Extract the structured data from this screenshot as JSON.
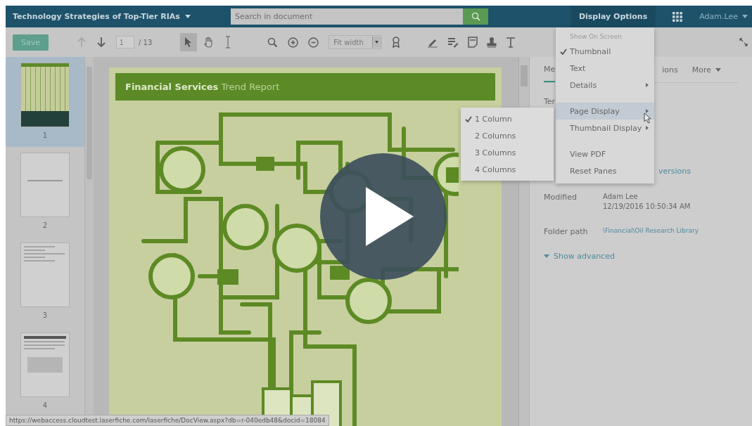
{
  "header": {
    "title": "Technology Strategies of Top-Tier RIAs",
    "search": {
      "placeholder": "Search in document"
    },
    "display_options": "Display Options",
    "user": "Adam.Lee"
  },
  "toolbar": {
    "save": "Save",
    "prev_disabled": true,
    "page": "1",
    "page_total": "/ 13",
    "zoom": "Fit width",
    "tools": [
      {
        "kind": "pointer",
        "selected": true
      },
      {
        "kind": "hand",
        "selected": false
      },
      {
        "kind": "text-select",
        "selected": false
      }
    ]
  },
  "thumbnails": [
    {
      "label": "1",
      "kind": "cover",
      "selected": true
    },
    {
      "label": "2",
      "kind": "title",
      "selected": false
    },
    {
      "label": "3",
      "kind": "contents",
      "selected": false
    },
    {
      "label": "4",
      "kind": "text",
      "selected": false
    }
  ],
  "document": {
    "heading": "**Financial Services** Trend Report"
  },
  "details_pane": {
    "tabs": [
      {
        "label": "Me",
        "selected": true
      },
      {
        "label": "ions",
        "selected": false
      },
      {
        "label": "More",
        "selected": false
      }
    ],
    "partial_label": "Ter",
    "versions_link": "versions",
    "fields": [
      {
        "label": "Modified",
        "kind": "text",
        "values": [
          "Adam Lee",
          "12/19/2016 10:50:34 AM"
        ]
      },
      {
        "label": "Folder path",
        "kind": "link",
        "values": [
          "\\Financial\\Oil Research Library"
        ]
      }
    ],
    "show_advanced": "Show advanced"
  },
  "display_menu": {
    "section": "Show On Screen",
    "items": [
      {
        "label": "Thumbnail",
        "kind": "check",
        "checked": true,
        "highlighted": false
      },
      {
        "label": "Text",
        "kind": "check",
        "checked": false,
        "highlighted": false
      },
      {
        "label": "Details",
        "kind": "submenu",
        "highlighted": false
      },
      {
        "kind": "separator"
      },
      {
        "label": "Page Display",
        "kind": "submenu",
        "highlighted": true
      },
      {
        "label": "Thumbnail Display",
        "kind": "submenu",
        "highlighted": false
      },
      {
        "kind": "separator"
      },
      {
        "label": "View PDF",
        "kind": "action",
        "highlighted": false
      },
      {
        "label": "Reset Panes",
        "kind": "action",
        "highlighted": false
      }
    ]
  },
  "page_display_submenu": [
    {
      "label": "1 Column",
      "selected": true
    },
    {
      "label": "2 Columns",
      "selected": false
    },
    {
      "label": "3 Columns",
      "selected": false
    },
    {
      "label": "4 Columns",
      "selected": false
    }
  ],
  "status_url": "https://webaccess.cloudtest.laserfiche.com/laserfiche/DocView.aspx?db=r-040edb48&docid=18084"
}
